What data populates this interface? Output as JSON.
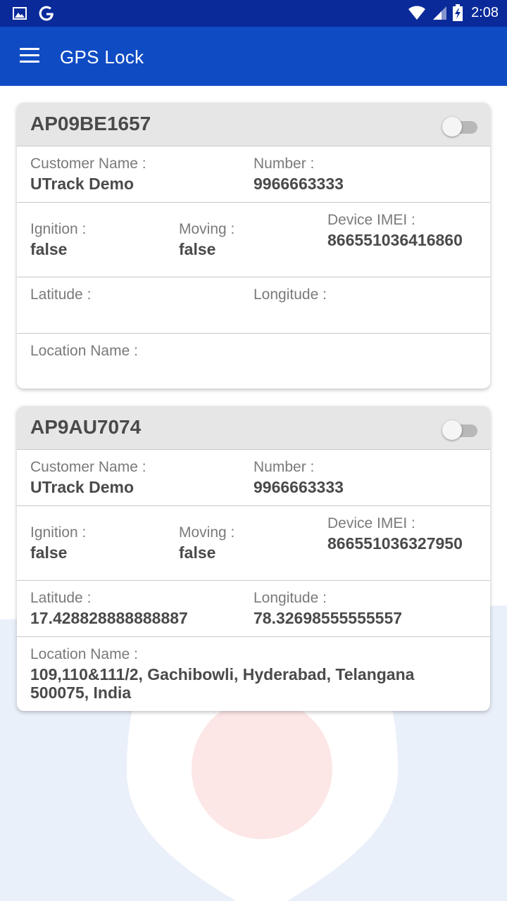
{
  "status_bar": {
    "time": "2:08",
    "left_icons": [
      "image-icon",
      "google-icon"
    ],
    "right_icons": [
      "wifi-icon",
      "signal-icon",
      "battery-icon"
    ]
  },
  "app_bar": {
    "title": "GPS Lock",
    "menu_icon": "menu-icon"
  },
  "colors": {
    "status_bar": "#0a2a9a",
    "app_bar": "#0f4cc4",
    "card_header": "#e6e6e6",
    "label": "#7a7a7a",
    "value": "#4a4a4a"
  },
  "labels": {
    "customer_name": "Customer Name :",
    "number": "Number :",
    "ignition": "Ignition :",
    "moving": "Moving :",
    "device_imei": "Device IMEI :",
    "latitude": "Latitude :",
    "longitude": "Longitude :",
    "location_name": "Location Name :"
  },
  "vehicles": [
    {
      "plate": "AP09BE1657",
      "lock_on": false,
      "customer_name": "UTrack Demo",
      "number": "9966663333",
      "ignition": "false",
      "moving": "false",
      "device_imei": "866551036416860",
      "latitude": "",
      "longitude": "",
      "location_name": ""
    },
    {
      "plate": "AP9AU7074",
      "lock_on": false,
      "customer_name": "UTrack Demo",
      "number": "9966663333",
      "ignition": "false",
      "moving": "false",
      "device_imei": "866551036327950",
      "latitude": "17.428828888888887",
      "longitude": "78.32698555555557",
      "location_name": "109,110&111/2, Gachibowli, Hyderabad, Telangana 500075, India"
    }
  ]
}
